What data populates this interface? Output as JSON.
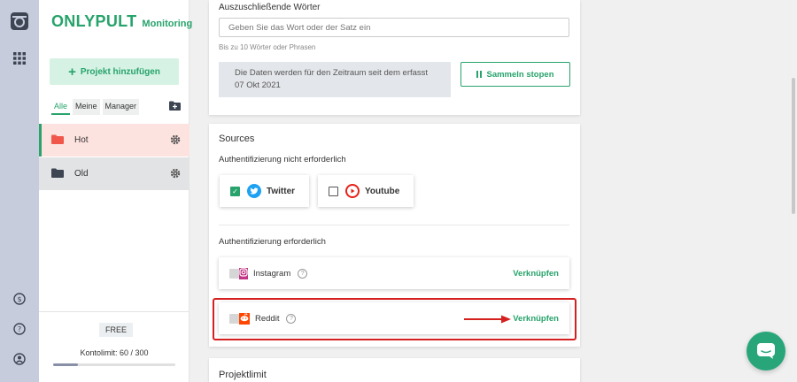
{
  "brand": {
    "name": "ONLYPULT",
    "sub": "Monitoring"
  },
  "sidebar": {
    "add_project": "Projekt hinzufügen",
    "filters": [
      "Alle",
      "Meine",
      "Manager"
    ],
    "projects": [
      {
        "name": "Hot",
        "color": "#f0564a"
      },
      {
        "name": "Old",
        "color": "#3d4452"
      }
    ],
    "plan": "FREE",
    "account_limit": "Kontolimit: 60 / 300",
    "account_limit_fraction": 0.2
  },
  "excluded": {
    "label": "Auszuschließende Wörter",
    "placeholder": "Geben Sie das Wort oder der Satz ein",
    "hint": "Bis zu 10 Wörter oder Phrasen",
    "info": "Die Daten werden für den Zeitraum seit dem erfasst 07 Okt 2021",
    "stop_button": "Sammeln stopen"
  },
  "sources": {
    "title": "Sources",
    "no_auth_label": "Authentifizierung nicht erforderlich",
    "no_auth": [
      {
        "name": "Twitter",
        "checked": true,
        "color": "#1da1f2"
      },
      {
        "name": "Youtube",
        "checked": false,
        "color": "#e62117"
      }
    ],
    "auth_label": "Authentifizierung erforderlich",
    "auth": [
      {
        "name": "Instagram",
        "link": "Verknüpfen",
        "color": "#c13584"
      },
      {
        "name": "Reddit",
        "link": "Verknüpfen",
        "color": "#ff4500"
      }
    ]
  },
  "project_limit": {
    "title": "Projektlimit"
  },
  "colors": {
    "accent": "#27a36b",
    "highlight": "#d52020"
  }
}
